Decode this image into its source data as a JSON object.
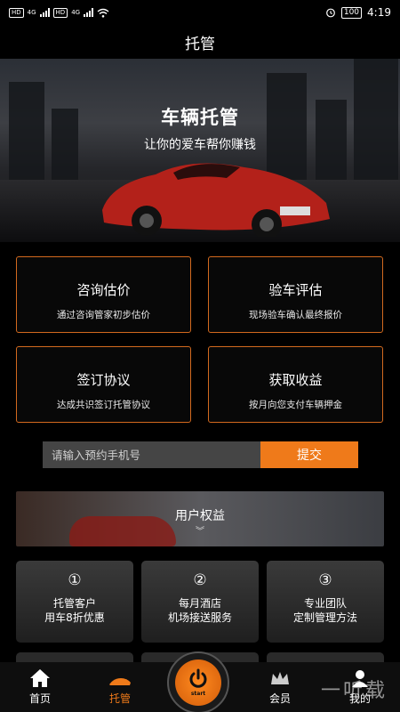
{
  "status_bar": {
    "time": "4:19",
    "battery": "100",
    "net_label": "HD",
    "net_type": "4G"
  },
  "header": {
    "title": "托管"
  },
  "hero": {
    "title": "车辆托管",
    "subtitle": "让你的爱车帮你赚钱"
  },
  "services": [
    {
      "title": "咨询估价",
      "desc": "通过咨询管家初步估价"
    },
    {
      "title": "验车评估",
      "desc": "现场验车确认最终报价"
    },
    {
      "title": "签订协议",
      "desc": "达成共识签订托管协议"
    },
    {
      "title": "获取收益",
      "desc": "按月向您支付车辆押金"
    }
  ],
  "form": {
    "placeholder": "请输入预约手机号",
    "submit_label": "提交"
  },
  "benefits": {
    "title": "用户权益",
    "cards": [
      {
        "num": "①",
        "text": "托管客户\n用车8折优惠"
      },
      {
        "num": "②",
        "text": "每月酒店\n机场接送服务"
      },
      {
        "num": "③",
        "text": "专业团队\n定制管理方法"
      }
    ]
  },
  "nav": {
    "home": "首页",
    "trust": "托管",
    "start": "start",
    "member": "会员",
    "mine": "我的"
  },
  "watermark": "一听载",
  "colors": {
    "accent": "#ef7a1a",
    "border": "#d2691e",
    "background": "#000000"
  }
}
